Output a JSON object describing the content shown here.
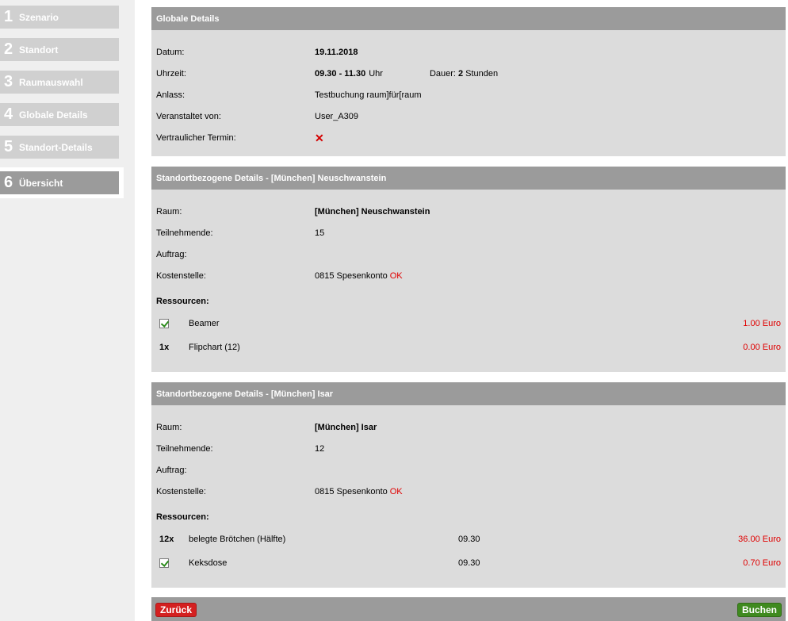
{
  "sidebar": {
    "steps": [
      {
        "num": "1",
        "label": "Szenario"
      },
      {
        "num": "2",
        "label": "Standort"
      },
      {
        "num": "3",
        "label": "Raumauswahl"
      },
      {
        "num": "4",
        "label": "Globale Details"
      },
      {
        "num": "5",
        "label": "Standort-Details"
      },
      {
        "num": "6",
        "label": "Übersicht"
      }
    ],
    "active_step": 6
  },
  "global": {
    "title": "Globale Details",
    "datum_label": "Datum:",
    "datum_value": "19.11.2018",
    "uhrzeit_label": "Uhrzeit:",
    "uhrzeit_value": "09.30 - 11.30",
    "uhrzeit_unit": "Uhr",
    "dauer_label": "Dauer:",
    "dauer_value": "2",
    "dauer_unit": "Stunden",
    "anlass_label": "Anlass:",
    "anlass_value": "Testbuchung raum]für[raum",
    "veranstaltet_label": "Veranstaltet von:",
    "veranstaltet_value": "User_A309",
    "vertraulich_label": "Vertraulicher Termin:",
    "vertraulich_icon": "cross-icon"
  },
  "sites": [
    {
      "title": "Standortbezogene Details  -  [München] Neuschwanstein",
      "raum_label": "Raum:",
      "raum_value": "[München] Neuschwanstein",
      "teilnehmende_label": "Teilnehmende:",
      "teilnehmende_value": "15",
      "auftrag_label": "Auftrag:",
      "auftrag_value": "",
      "kostenstelle_label": "Kostenstelle:",
      "kostenstelle_value": "0815 Spesenkonto",
      "kostenstelle_status": "OK",
      "ressourcen_label": "Ressourcen:",
      "resources": [
        {
          "qty": "",
          "checked": true,
          "name": "Beamer",
          "time": "",
          "price": "1.00 Euro"
        },
        {
          "qty": "1x",
          "checked": false,
          "name": "Flipchart (12)",
          "time": "",
          "price": "0.00 Euro"
        }
      ]
    },
    {
      "title": "Standortbezogene Details  -  [München] Isar",
      "raum_label": "Raum:",
      "raum_value": "[München] Isar",
      "teilnehmende_label": "Teilnehmende:",
      "teilnehmende_value": "12",
      "auftrag_label": "Auftrag:",
      "auftrag_value": "",
      "kostenstelle_label": "Kostenstelle:",
      "kostenstelle_value": "0815 Spesenkonto",
      "kostenstelle_status": "OK",
      "ressourcen_label": "Ressourcen:",
      "resources": [
        {
          "qty": "12x",
          "checked": false,
          "name": "belegte Brötchen (Hälfte)",
          "time": "09.30",
          "price": "36.00 Euro"
        },
        {
          "qty": "",
          "checked": true,
          "name": "Keksdose",
          "time": "09.30",
          "price": "0.70 Euro"
        }
      ]
    }
  ],
  "footer": {
    "back_label": "Zurück",
    "book_label": "Buchen"
  },
  "colors": {
    "accent_red": "#e00000",
    "back_button": "#d42020",
    "book_button": "#3f8a1f",
    "header_gray": "#9b9b9b",
    "panel_gray": "#dcdcdc"
  }
}
